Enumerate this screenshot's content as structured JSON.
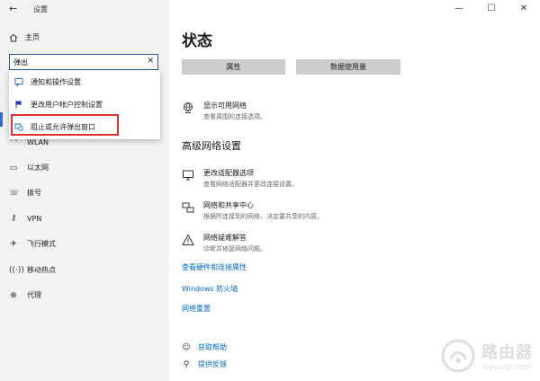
{
  "window": {
    "title": "设置",
    "minimize": "—",
    "maximize": "☐",
    "close": "✕"
  },
  "sidebar": {
    "home_label": "主页",
    "search": {
      "value": "弹出",
      "placeholder": ""
    },
    "dropdown": [
      {
        "label": "通知和操作设置",
        "icon": "notification-icon"
      },
      {
        "label": "更改用户帐户控制设置",
        "icon": "flag-icon"
      },
      {
        "label": "阻止或允许弹出窗口",
        "icon": "popup-icon"
      }
    ],
    "items": [
      {
        "label": "WLAN",
        "icon": "wifi-icon"
      },
      {
        "label": "以太网",
        "icon": "ethernet-icon"
      },
      {
        "label": "拨号",
        "icon": "dialup-icon"
      },
      {
        "label": "VPN",
        "icon": "vpn-icon"
      },
      {
        "label": "飞行模式",
        "icon": "airplane-icon"
      },
      {
        "label": "移动热点",
        "icon": "hotspot-icon"
      },
      {
        "label": "代理",
        "icon": "globe-icon"
      }
    ]
  },
  "main": {
    "title": "状态",
    "buttons": {
      "properties": "属性",
      "data_usage": "数据使用量"
    },
    "show_networks": {
      "title": "显示可用网络",
      "subtitle": "查看周围的连接选项。"
    },
    "advanced_title": "高级网络设置",
    "adapter": {
      "title": "更改适配器选项",
      "subtitle": "查看网络适配器并更改连接设置。"
    },
    "sharing": {
      "title": "网络和共享中心",
      "subtitle": "根据所连接到的网络，决定要共享的内容。"
    },
    "troubleshoot": {
      "title": "网络疑难解答",
      "subtitle": "诊断并修复网络问题。"
    },
    "links": {
      "hardware": "查看硬件和连接属性",
      "firewall": "Windows 防火墙",
      "reset": "网络重置"
    },
    "help": {
      "get_help": "获取帮助",
      "feedback": "提供反馈"
    }
  },
  "watermark": {
    "cn": "路由器",
    "en": "luyouqi.com"
  },
  "colors": {
    "accent": "#0067c0",
    "highlight": "#e03131",
    "sidebar_bg": "#f2f2f2"
  }
}
